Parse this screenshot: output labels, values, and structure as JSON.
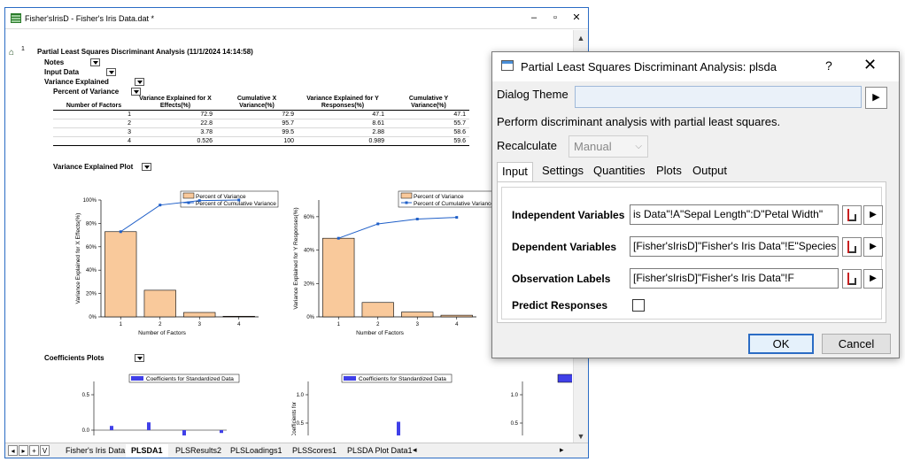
{
  "workbook": {
    "title": "Fisher'sIrisD - Fisher's Iris Data.dat *",
    "min_label": "–",
    "max_label": "▫",
    "close_label": "✕",
    "report_index": "1",
    "report_title": "Partial Least Squares Discriminant Analysis (11/1/2024 14:14:58)",
    "tree": {
      "notes": "Notes",
      "input_data": "Input Data",
      "variance_explained": "Variance Explained",
      "percent_of_variance": "Percent of Variance"
    },
    "variance_table": {
      "headers": [
        "Number of Factors",
        "Variance Explained for X Effects(%)",
        "Cumulative X Variance(%)",
        "Variance Explained for Y Responses(%)",
        "Cumulative Y Variance(%)"
      ],
      "rows": [
        [
          "1",
          "72.9",
          "72.9",
          "47.1",
          "47.1"
        ],
        [
          "2",
          "22.8",
          "95.7",
          "8.61",
          "55.7"
        ],
        [
          "3",
          "3.78",
          "99.5",
          "2.88",
          "58.6"
        ],
        [
          "4",
          "0.526",
          "100",
          "0.989",
          "59.6"
        ]
      ]
    },
    "variance_plot_label": "Variance Explained Plot",
    "coefficients_label": "Coefficients Plots",
    "sheet_tabs": [
      "Fisher's Iris Data",
      "PLSDA1",
      "PLSResults2",
      "PLSLoadings1",
      "PLSScores1",
      "PLSDA Plot Data1"
    ],
    "active_tab": "PLSDA1",
    "nav": [
      "◂",
      "▸",
      "+",
      "V"
    ]
  },
  "chart_data": [
    {
      "type": "bar",
      "categories": [
        "1",
        "2",
        "3",
        "4"
      ],
      "series": [
        {
          "name": "Percent of Variance",
          "values": [
            72.9,
            22.8,
            3.78,
            0.526
          ]
        },
        {
          "name": "Percent of Cumulative Variance",
          "values": [
            72.9,
            95.7,
            99.5,
            100
          ]
        }
      ],
      "xlabel": "Number of Factors",
      "ylabel": "Variance Explained for X Effects(%)",
      "ylim": [
        0,
        100
      ],
      "yticks": [
        "0%",
        "20%",
        "40%",
        "60%",
        "80%",
        "100%"
      ],
      "legend": "top-right"
    },
    {
      "type": "bar",
      "categories": [
        "1",
        "2",
        "3",
        "4"
      ],
      "series": [
        {
          "name": "Percent of Variance",
          "values": [
            47.1,
            8.61,
            2.88,
            0.989
          ]
        },
        {
          "name": "Percent of Cumulative Variance",
          "values": [
            47.1,
            55.7,
            58.6,
            59.6
          ]
        }
      ],
      "xlabel": "Number of Factors",
      "ylabel": "Variance Explained for Y Responses(%)",
      "ylim": [
        0,
        70
      ],
      "yticks": [
        "0%",
        "20%",
        "40%",
        "60%"
      ],
      "legend": "top-right"
    },
    {
      "type": "bar",
      "legend_label": "Coefficients for Standardized Data",
      "yticks": [
        "0.5",
        "0.0"
      ],
      "values": [
        0.12,
        0.22,
        -0.3,
        -0.08
      ]
    },
    {
      "type": "bar",
      "legend_label": "Coefficients for Standardized Data",
      "yticks": [
        "1.0",
        "0.5"
      ],
      "values": [
        0.82
      ],
      "ylabel_fragment": "Coefficients for"
    },
    {
      "type": "bar",
      "yticks": [
        "1.0",
        "0.5"
      ]
    }
  ],
  "colors": {
    "bar_fill": "#f9c99b",
    "bar_stroke": "#000000",
    "line": "#1f5fc8",
    "coef_bar": "#4040e8"
  },
  "dialog": {
    "title": "Partial Least Squares Discriminant Analysis: plsda",
    "help": "?",
    "close": "✕",
    "theme_label": "Dialog Theme",
    "theme_arrow": "▶",
    "description": "Perform discriminant analysis with partial least squares.",
    "recalc_label": "Recalculate",
    "recalc_value": "Manual",
    "tabs": [
      "Input",
      "Settings",
      "Quantities",
      "Plots",
      "Output"
    ],
    "fields": {
      "independent_label": "Independent Variables",
      "independent_value": "is Data\"!A\"Sepal Length\":D\"Petal Width\"",
      "dependent_label": "Dependent Variables",
      "dependent_value": "[Fisher'sIrisD]\"Fisher's Iris Data\"!E\"Species",
      "observation_label": "Observation Labels",
      "observation_value": "[Fisher'sIrisD]\"Fisher's Iris Data\"!F",
      "predict_label": "Predict Responses"
    },
    "ok": "OK",
    "cancel": "Cancel"
  }
}
